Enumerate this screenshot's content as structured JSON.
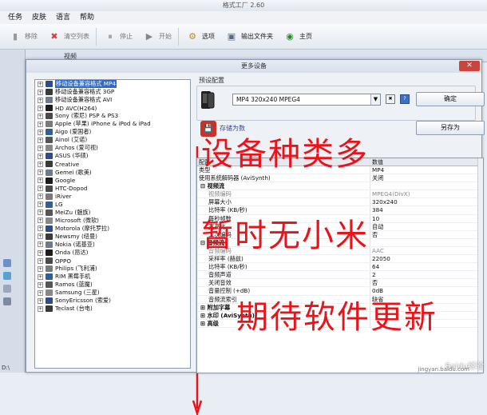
{
  "app": {
    "title": "格式工厂 2.60"
  },
  "menu": [
    "任务",
    "皮肤",
    "语言",
    "帮助"
  ],
  "toolbar": [
    {
      "label": "移除",
      "icon": "remove-icon",
      "active": false
    },
    {
      "label": "清空列表",
      "icon": "clear-list-icon",
      "active": false
    },
    {
      "label": "停止",
      "icon": "stop-icon",
      "active": false
    },
    {
      "label": "开始",
      "icon": "start-icon",
      "active": false
    },
    {
      "label": "选项",
      "icon": "options-icon",
      "active": true
    },
    {
      "label": "输出文件夹",
      "icon": "output-folder-icon",
      "active": true
    },
    {
      "label": "主页",
      "icon": "home-icon",
      "active": true
    }
  ],
  "main": {
    "video_tab": "视频",
    "bottom_tab": "D:\\"
  },
  "dialog": {
    "title": "更多设备",
    "preset_label": "预设配置",
    "preset_value": "MP4 320x240 MPEG4",
    "ok_button": "确定",
    "save_as_button": "另存为",
    "save_preset_label": "存储为数"
  },
  "device_tree": [
    "移动设备兼容格式 MP4",
    "移动设备兼容格式 3GP",
    "移动设备兼容格式 AVI",
    "HD AVC(H264)",
    "Sony (索尼) PSP & PS3",
    "Apple (苹果) iPhone & iPod & iPad",
    "Aigo (爱国者)",
    "Ainol (艾诺)",
    "Archos (爱可视)",
    "ASUS (华硕)",
    "Creative",
    "Gemei (歌美)",
    "Google",
    "HTC-Dopod",
    "iRiver",
    "LG",
    "MeiZu (魅族)",
    "Microsoft (微软)",
    "Motorola (摩托罗拉)",
    "Newsmy (纽曼)",
    "Nokia (诺基亚)",
    "Onda (昂达)",
    "OPPO",
    "Philips (飞利浦)",
    "RIM 黑莓手机",
    "Ramos (蓝魔)",
    "Samsung (三星)",
    "SonyEricsson (索爱)",
    "Teclast (台电)"
  ],
  "properties": {
    "header_key": "配置",
    "header_value": "数值",
    "rows": [
      {
        "k": "类型",
        "v": "MP4",
        "kind": "row"
      },
      {
        "k": "使用系统解码器 (AviSynth)",
        "v": "关闭",
        "kind": "row"
      },
      {
        "k": "视频流",
        "v": "",
        "kind": "cat"
      },
      {
        "k": "视频编码",
        "v": "MPEG4(DivX)",
        "kind": "dim"
      },
      {
        "k": "屏幕大小",
        "v": "320x240",
        "kind": "sub"
      },
      {
        "k": "比特率 (KB/秒)",
        "v": "384",
        "kind": "sub"
      },
      {
        "k": "每秒帧数",
        "v": "10",
        "kind": "sub"
      },
      {
        "k": "宽高比",
        "v": "自动",
        "kind": "sub"
      },
      {
        "k": "二次编码",
        "v": "否",
        "kind": "sub"
      },
      {
        "k": "音频流",
        "v": "",
        "kind": "cat"
      },
      {
        "k": "音频编码",
        "v": "AAC",
        "kind": "dim"
      },
      {
        "k": "采样率 (赫兹)",
        "v": "22050",
        "kind": "sub"
      },
      {
        "k": "比特率 (KB/秒)",
        "v": "64",
        "kind": "sub"
      },
      {
        "k": "音频声道",
        "v": "2",
        "kind": "sub"
      },
      {
        "k": "关闭音效",
        "v": "否",
        "kind": "sub"
      },
      {
        "k": "音量控制 (+dB)",
        "v": "0dB",
        "kind": "sub"
      },
      {
        "k": "音频流索引",
        "v": "缺省",
        "kind": "sub"
      },
      {
        "k": "附加字幕",
        "v": "",
        "kind": "cat"
      },
      {
        "k": "水印 (AviSynth)",
        "v": "",
        "kind": "cat"
      },
      {
        "k": "高级",
        "v": "",
        "kind": "cat"
      }
    ]
  },
  "overlay": [
    "设备种类多",
    "暂时无小米",
    "期待软件更新"
  ],
  "watermark": {
    "brand": "Baidu经验",
    "url": "jingyan.baidu.com"
  },
  "colors": {
    "overlay_text": "#e8141a",
    "arrow": "#e8141a",
    "selection": "#3169c6"
  }
}
